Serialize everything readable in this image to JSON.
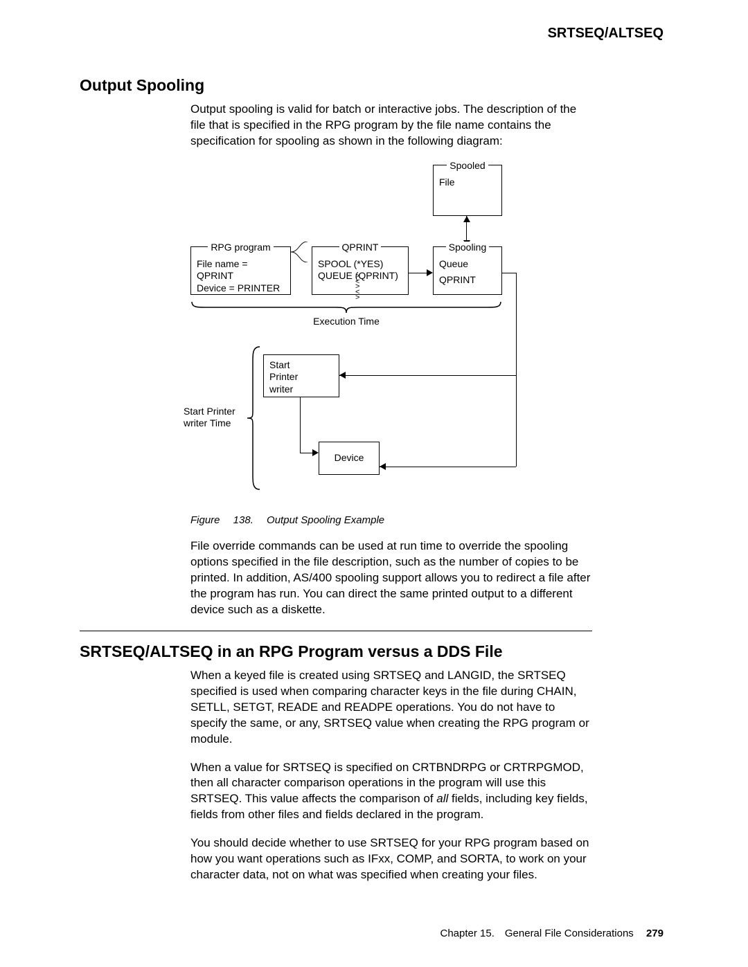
{
  "header": {
    "running": "SRTSEQ/ALTSEQ"
  },
  "section1": {
    "title": "Output Spooling",
    "p1": "Output spooling is valid for batch or interactive jobs. The description of the file that is specified in the RPG program by the file name contains the specification for spooling as shown in the following diagram:",
    "p2": "File override commands can be used at run time to override the spooling options specified in the file description, such as the number of copies to be printed. In addition, AS/400 spooling support allows you to redirect a file after the program has run. You can direct the same printed output to a different device such as a diskette."
  },
  "diagram": {
    "rpg_label": "RPG program",
    "rpg_l1": "File name = QPRINT",
    "rpg_l2": "Device = PRINTER",
    "qprint_label": "QPRINT",
    "qprint_l1": "SPOOL (*YES)",
    "qprint_l2": "QUEUE (QPRINT)",
    "spooled_label": "Spooled",
    "spooled_l1": "File",
    "spoolq_label": "Spooling",
    "spoolq_l1": "Queue",
    "spoolq_l2": "QPRINT",
    "exec_time": "Execution Time",
    "start_pw_l1": "Start",
    "start_pw_l2": "Printer",
    "start_pw_l3": "writer",
    "spwt_l1": "Start Printer",
    "spwt_l2": "writer Time",
    "device": "Device"
  },
  "figure": {
    "caption": "Figure  138.  Output Spooling Example"
  },
  "section2": {
    "title": "SRTSEQ/ALTSEQ in an RPG Program versus a DDS File",
    "p1": "When a keyed file is created using SRTSEQ and LANGID, the SRTSEQ specified is used when comparing character keys in the file during CHAIN, SETLL, SETGT, READE and READPE operations. You do not have to specify the same, or any, SRTSEQ value when creating the RPG program or module.",
    "p2a": "When a value for SRTSEQ is specified on CRTBNDRPG or CRTRPGMOD, then all character comparison operations in the program will use this SRTSEQ. This value affects the comparison of ",
    "p2_em": "all",
    "p2b": " fields, including key fields, fields from other files and fields declared in the program.",
    "p3": "You should decide whether to use SRTSEQ for your RPG program based on how you want operations such as IFxx, COMP, and SORTA, to work on your character data, not on what was specified when creating your files."
  },
  "footer": {
    "chapter": "Chapter 15. General File Considerations",
    "page": "279"
  }
}
